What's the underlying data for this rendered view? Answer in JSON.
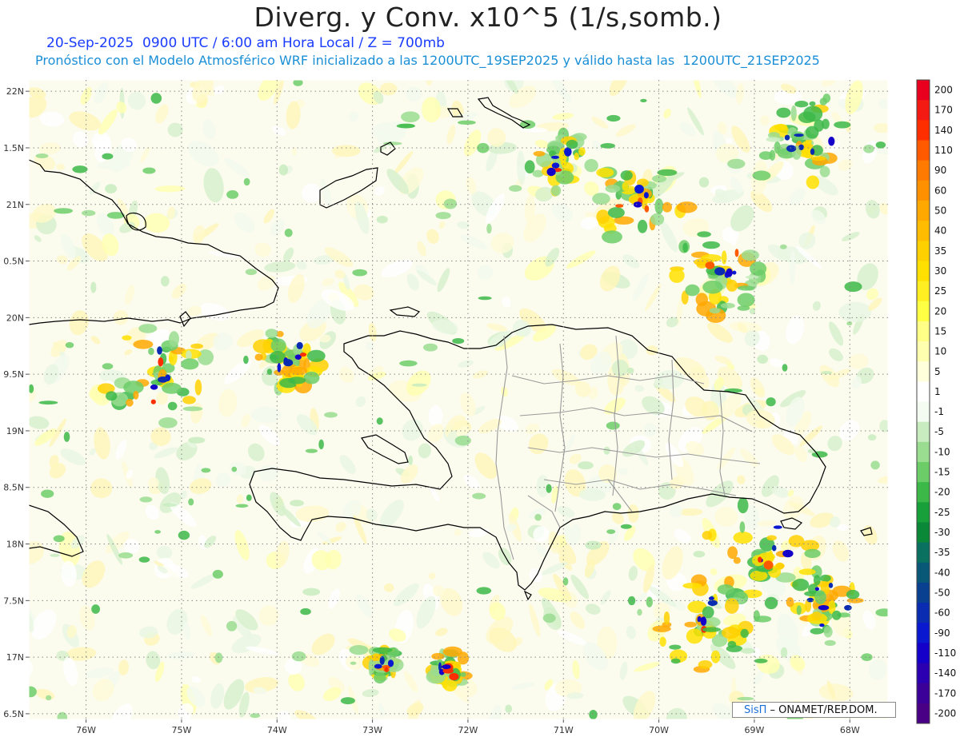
{
  "header": {
    "title": "Diverg. y Conv. x10^5 (1/s,somb.)",
    "subtitle_line1": "20-Sep-2025  0900 UTC / 6:00 am Hora Local / Z = 700mb",
    "subtitle_line2": "Pronóstico con el Modelo Atmosférico WRF inicializado a las 1200UTC_19SEP2025 y válido hasta las  1200UTC_21SEP2025"
  },
  "credit": {
    "brand": "SisΠ",
    "text": " – ONAMET/REP.DOM."
  },
  "chart_data": {
    "type": "heatmap",
    "xlabel": "",
    "ylabel": "",
    "x_ticks": [
      "76W",
      "75W",
      "74W",
      "73W",
      "72W",
      "71W",
      "70W",
      "69W",
      "68W"
    ],
    "x_tick_values": [
      -76,
      -75,
      -74,
      -73,
      -72,
      -71,
      -70,
      -69,
      -68
    ],
    "y_ticks": [
      "22N",
      "1.5N",
      "21N",
      "0.5N",
      "20N",
      "9.5N",
      "19N",
      "8.5N",
      "18N",
      "7.5N",
      "17N",
      "6.5N"
    ],
    "y_tick_values": [
      22,
      21.5,
      21,
      20.5,
      20,
      19.5,
      19,
      18.5,
      18,
      17.5,
      17,
      16.5
    ],
    "xlim": [
      -76.6,
      -67.6
    ],
    "ylim": [
      16.45,
      22.1
    ],
    "grid": true,
    "colorbar": {
      "placement": "right",
      "levels": [
        "200",
        "170",
        "140",
        "110",
        "90",
        "60",
        "50",
        "40",
        "35",
        "30",
        "25",
        "20",
        "15",
        "10",
        "5",
        "1",
        "-1",
        "-5",
        "-10",
        "-15",
        "-20",
        "-25",
        "-30",
        "-35",
        "-40",
        "-50",
        "-60",
        "-90",
        "-110",
        "-140",
        "-170",
        "-200"
      ],
      "colors": [
        "#e8001e",
        "#f21a12",
        "#ff2e00",
        "#ff5a00",
        "#ff7a00",
        "#ff9000",
        "#ffa800",
        "#ffbc00",
        "#ffd000",
        "#ffe000",
        "#ffee22",
        "#ffff44",
        "#ffff88",
        "#ffffb0",
        "#ffffdc",
        "#ffffff",
        "#f4fbf0",
        "#c8ecc0",
        "#9adc90",
        "#6ccc68",
        "#3cb848",
        "#18a03a",
        "#0a8838",
        "#0a7060",
        "#0a5878",
        "#0a4090",
        "#0a2cb0",
        "#0a18d0",
        "#1400c8",
        "#2a00b0",
        "#3a0098",
        "#4a0084"
      ]
    },
    "features": {
      "regions": [
        "Cuba (east)",
        "Bahamas",
        "Haiti",
        "República Dominicana",
        "Jamaica",
        "Puerto Rico (west)"
      ]
    }
  },
  "colors": {
    "title": "#222222",
    "subtitle1": "#1a3cff",
    "subtitle2": "#1a8fd6",
    "coast": "#000000",
    "provinces": "#9a9a9a"
  }
}
